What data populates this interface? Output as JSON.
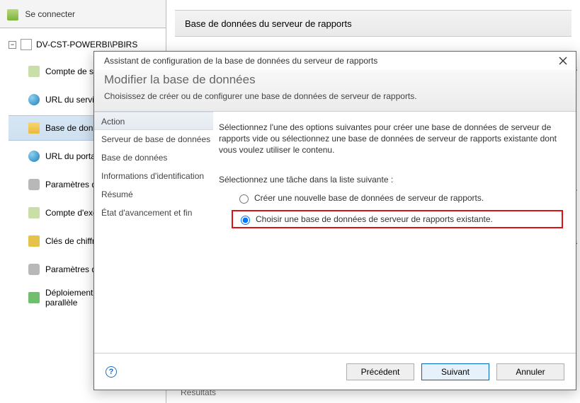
{
  "connect_label": "Se connecter",
  "server_node": "DV-CST-POWERBI\\PBIRS",
  "nav": {
    "items": [
      "Compte de service",
      "URL du service Web",
      "Base de données",
      "URL du portail Web",
      "Paramètres de messagerie",
      "Compte d'exécution",
      "Clés de chiffrement",
      "Paramètres d'abonnement",
      "Déploiement avec puissance parallèle"
    ],
    "selected_index": 2
  },
  "bg_title": "Base de données du serveur de rapports",
  "bg_snip_top": "dans",
  "bg_snip_mid": "fier",
  "bg_snip_low": "ata",
  "bg_results": "Resultats",
  "dialog": {
    "title": "Assistant de configuration de la base de données du serveur de rapports",
    "heading": "Modifier la base de données",
    "subheading": "Choisissez de créer ou de configurer une base de données de serveur de rapports.",
    "steps": [
      "Action",
      "Serveur de base de données",
      "Base de données",
      "Informations d'identification",
      "Résumé",
      "État d'avancement et fin"
    ],
    "step_active_index": 0,
    "intro": "Sélectionnez l'une des options suivantes pour créer une base de données de serveur de rapports vide ou sélectionnez une base de données de serveur de rapports existante dont vous voulez utiliser le contenu.",
    "task_label": "Sélectionnez une tâche dans la liste suivante :",
    "option_create": "Créer une nouvelle base de données de serveur de rapports.",
    "option_choose": "Choisir une base de données de serveur de rapports existante.",
    "selected_option": 1,
    "btn_prev": "Précédent",
    "btn_next": "Suivant",
    "btn_cancel": "Annuler"
  }
}
